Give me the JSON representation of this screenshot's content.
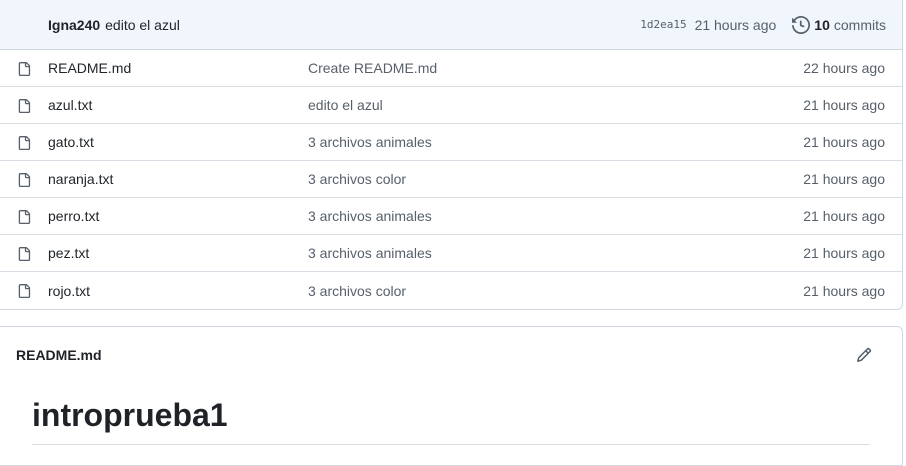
{
  "latest_commit": {
    "author": "Igna240",
    "message": "edito el azul",
    "sha": "1d2ea15",
    "age": "21 hours ago",
    "commits_count": "10",
    "commits_word": "commits"
  },
  "files": [
    {
      "name": "README.md",
      "commit": "Create README.md",
      "age": "22 hours ago"
    },
    {
      "name": "azul.txt",
      "commit": "edito el azul",
      "age": "21 hours ago"
    },
    {
      "name": "gato.txt",
      "commit": "3 archivos animales",
      "age": "21 hours ago"
    },
    {
      "name": "naranja.txt",
      "commit": "3 archivos color",
      "age": "21 hours ago"
    },
    {
      "name": "perro.txt",
      "commit": "3 archivos animales",
      "age": "21 hours ago"
    },
    {
      "name": "pez.txt",
      "commit": "3 archivos animales",
      "age": "21 hours ago"
    },
    {
      "name": "rojo.txt",
      "commit": "3 archivos color",
      "age": "21 hours ago"
    }
  ],
  "readme": {
    "filename": "README.md",
    "heading": "introprueba1"
  },
  "icons": {
    "file": "file-icon",
    "history": "history-icon",
    "edit": "pencil-icon"
  }
}
